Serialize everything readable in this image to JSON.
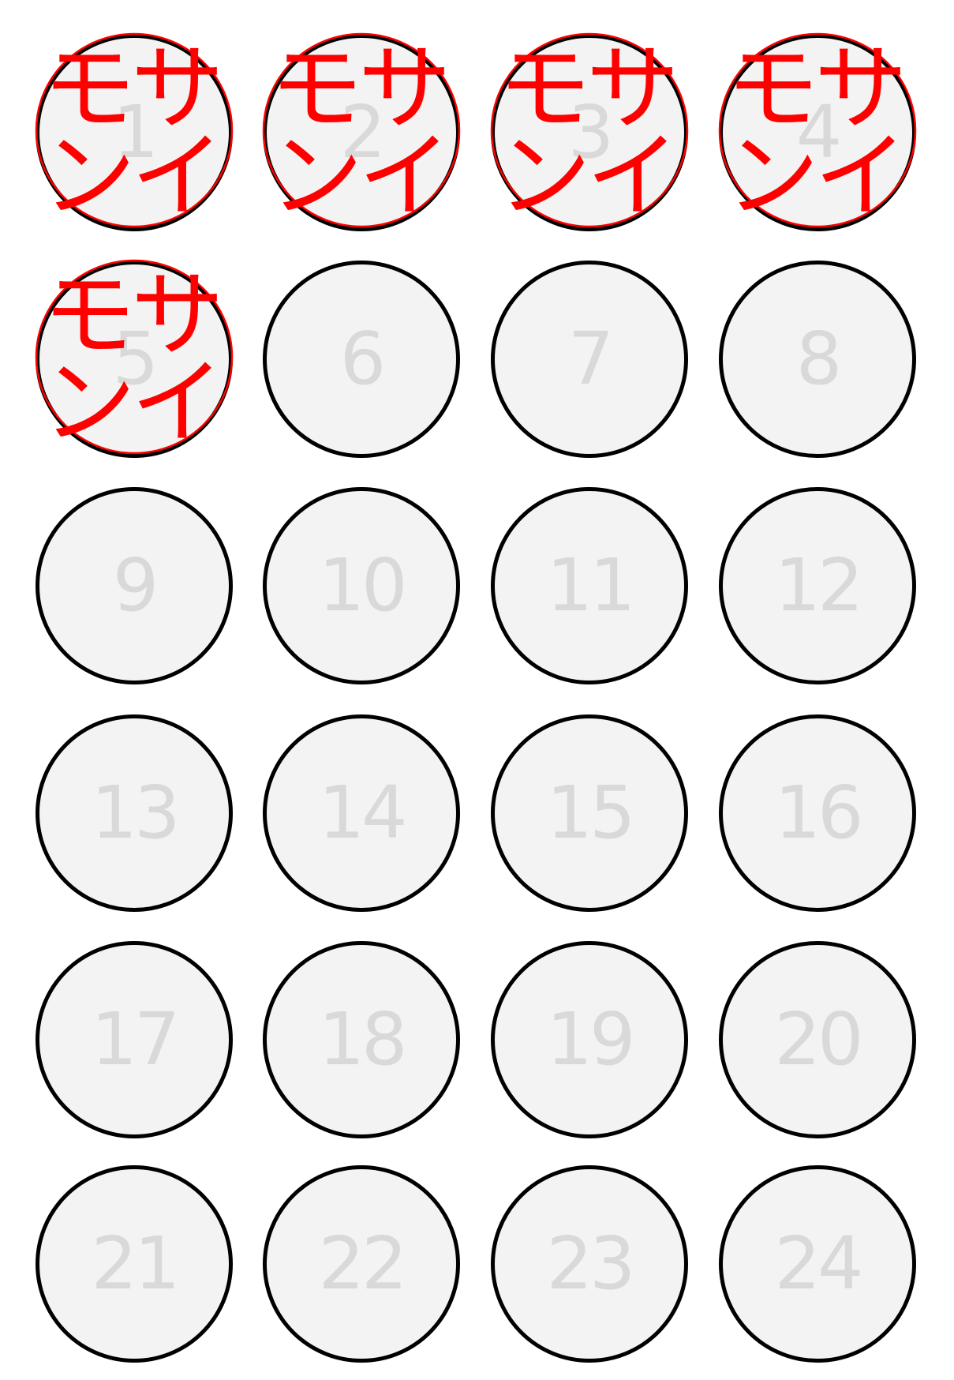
{
  "colors": {
    "circle_border": "#000000",
    "circle_fill": "#f3f3f3",
    "number_text": "#d9d9d9",
    "stamp_red": "#ff0000"
  },
  "stamp": {
    "text": "モサンイ",
    "chars": [
      "モ",
      "サ",
      "ン",
      "イ"
    ]
  },
  "slots": [
    {
      "number": "1",
      "stamped": true
    },
    {
      "number": "2",
      "stamped": true
    },
    {
      "number": "3",
      "stamped": true
    },
    {
      "number": "4",
      "stamped": true
    },
    {
      "number": "5",
      "stamped": true
    },
    {
      "number": "6",
      "stamped": false
    },
    {
      "number": "7",
      "stamped": false
    },
    {
      "number": "8",
      "stamped": false
    },
    {
      "number": "9",
      "stamped": false
    },
    {
      "number": "10",
      "stamped": false
    },
    {
      "number": "11",
      "stamped": false
    },
    {
      "number": "12",
      "stamped": false
    },
    {
      "number": "13",
      "stamped": false
    },
    {
      "number": "14",
      "stamped": false
    },
    {
      "number": "15",
      "stamped": false
    },
    {
      "number": "16",
      "stamped": false
    },
    {
      "number": "17",
      "stamped": false
    },
    {
      "number": "18",
      "stamped": false
    },
    {
      "number": "19",
      "stamped": false
    },
    {
      "number": "20",
      "stamped": false
    },
    {
      "number": "21",
      "stamped": false
    },
    {
      "number": "22",
      "stamped": false
    },
    {
      "number": "23",
      "stamped": false
    },
    {
      "number": "24",
      "stamped": false
    }
  ]
}
